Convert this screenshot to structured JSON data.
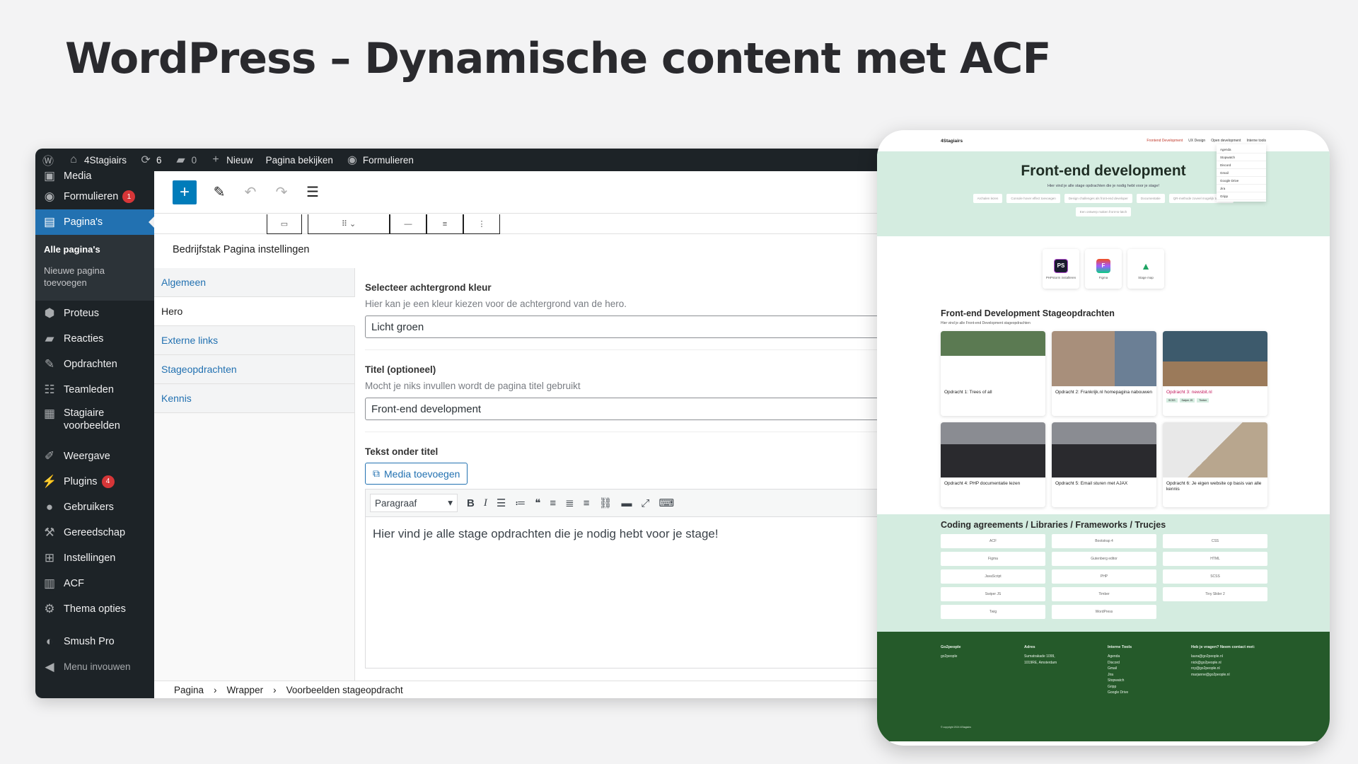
{
  "slide": {
    "title": "WordPress – Dynamische content met ACF"
  },
  "adminbar": {
    "site_name": "4Stagiairs",
    "updates": "6",
    "comments": "0",
    "new": "Nieuw",
    "view_page": "Pagina bekijken",
    "forms": "Formulieren"
  },
  "sidebar": {
    "items": [
      {
        "label": "Media",
        "icon": "media-icon"
      },
      {
        "label": "Formulieren",
        "icon": "forms-icon",
        "badge": "1"
      },
      {
        "label": "Pagina's",
        "icon": "pages-icon"
      },
      {
        "label": "Proteus",
        "icon": "proteus-icon"
      },
      {
        "label": "Reacties",
        "icon": "comments-icon"
      },
      {
        "label": "Opdrachten",
        "icon": "assignments-icon"
      },
      {
        "label": "Teamleden",
        "icon": "team-icon"
      },
      {
        "label": "Stagiaire voorbeelden",
        "icon": "examples-icon"
      },
      {
        "label": "Weergave",
        "icon": "appearance-icon"
      },
      {
        "label": "Plugins",
        "icon": "plugins-icon",
        "badge": "4"
      },
      {
        "label": "Gebruikers",
        "icon": "users-icon"
      },
      {
        "label": "Gereedschap",
        "icon": "tools-icon"
      },
      {
        "label": "Instellingen",
        "icon": "settings-icon"
      },
      {
        "label": "ACF",
        "icon": "acf-icon"
      },
      {
        "label": "Thema opties",
        "icon": "gear-icon"
      },
      {
        "label": "Smush Pro",
        "icon": "smush-icon"
      },
      {
        "label": "Menu invouwen",
        "icon": "collapse-icon"
      }
    ],
    "submenu": [
      "Alle pagina's",
      "Nieuwe pagina toevoegen"
    ]
  },
  "editor": {
    "group_title": "Bedrijfstak Pagina instellingen",
    "tabs": [
      "Algemeen",
      "Hero",
      "Externe links",
      "Stageopdrachten",
      "Kennis"
    ],
    "fields": {
      "bg": {
        "label": "Selecteer achtergrond kleur",
        "desc": "Hier kan je een kleur kiezen voor de achtergrond van de hero.",
        "value": "Licht groen"
      },
      "title": {
        "label": "Titel (optioneel)",
        "desc": "Mocht je niks invullen wordt de pagina titel gebruikt",
        "value": "Front-end development"
      },
      "text": {
        "label": "Tekst onder titel",
        "media_button": "Media toevoegen",
        "format": "Paragraaf",
        "content": "Hier vind je alle stage opdrachten die je nodig hebt voor je stage!"
      }
    },
    "breadcrumbs": [
      "Pagina",
      "Wrapper",
      "Voorbeelden stageopdracht"
    ]
  },
  "site": {
    "logo": "4Stagiairs",
    "nav": [
      "Frontend Development",
      "UX Design",
      "Open development",
      "Interne tools"
    ],
    "dropdown": [
      "Agenda",
      "Stopwatch",
      "Discord",
      "Gmail",
      "Google Drive",
      "Jira",
      "Gripp"
    ],
    "hero_title": "Front-end development",
    "hero_text": "Hier vind je alle stage opdrachten die je nodig hebt voor je stage!",
    "chips": [
      "Archalen lezen",
      "Console hover effect toevoegen",
      "Design challenges als front-end developer",
      "Documentatie",
      "QR-methode zoveel mogelijk toepassen",
      "Een ontwerp maken front-to-latch"
    ],
    "tools": [
      {
        "label": "PHPstorm installeren",
        "abbr": "PS"
      },
      {
        "label": "Figma",
        "abbr": "F"
      },
      {
        "label": "Stage map",
        "abbr": "▲"
      }
    ],
    "assignments_title": "Front-end Development Stageopdrachten",
    "assignments_sub": "Hier vind je alle Front-end Development stageopdrachten",
    "cards": [
      "Opdracht 1: Trees of all",
      "Opdracht 2: Frankrijk.nl homepagina nabouwen",
      "Opdracht 3: newsbit.nl",
      "Opdracht 4: PHP documentatie lezen",
      "Opdracht 5: Email sturen met AJAX",
      "Opdracht 6: Je eigen website op basis van alle kennis"
    ],
    "card3_tags": [
      "SCSS",
      "Swiper JS",
      "Timber"
    ],
    "agreements_title": "Coding agreements / Libraries / Frameworks / Trucjes",
    "agreements": [
      "ACF",
      "Bootstrap 4",
      "CSS",
      "Figma",
      "Gutenberg editor",
      "HTML",
      "JavaScript",
      "PHP",
      "SCSS",
      "Swiper JS",
      "Timber",
      "Tiny Slider 2",
      "Twig",
      "WordPress"
    ],
    "footer": {
      "col1_title": "Go2people",
      "col1_text": "go2people",
      "col2_title": "Adres",
      "col2_lines": [
        "Sumatrakade 1099,",
        "1019RE, Amsterdam"
      ],
      "col3_title": "Interne Tools",
      "col3_lines": [
        "Agenda",
        "Discord",
        "Gmail",
        "Jira",
        "Stopwatch",
        "Gripp",
        "Google Drive"
      ],
      "col4_title": "Heb je vragen? Neem contact met:",
      "col4_lines": [
        "laura@go2people.nl",
        "nick@go2people.nl",
        "roy@go2people.nl",
        "marjanne@go2people.nl"
      ],
      "copyright": "© copyright 2024 4Stagiairs"
    }
  },
  "colors": {
    "wp_blue": "#2271b1",
    "wp_dark": "#1d2327",
    "hero_green": "#d4ece0",
    "footer_green": "#255a2a"
  }
}
